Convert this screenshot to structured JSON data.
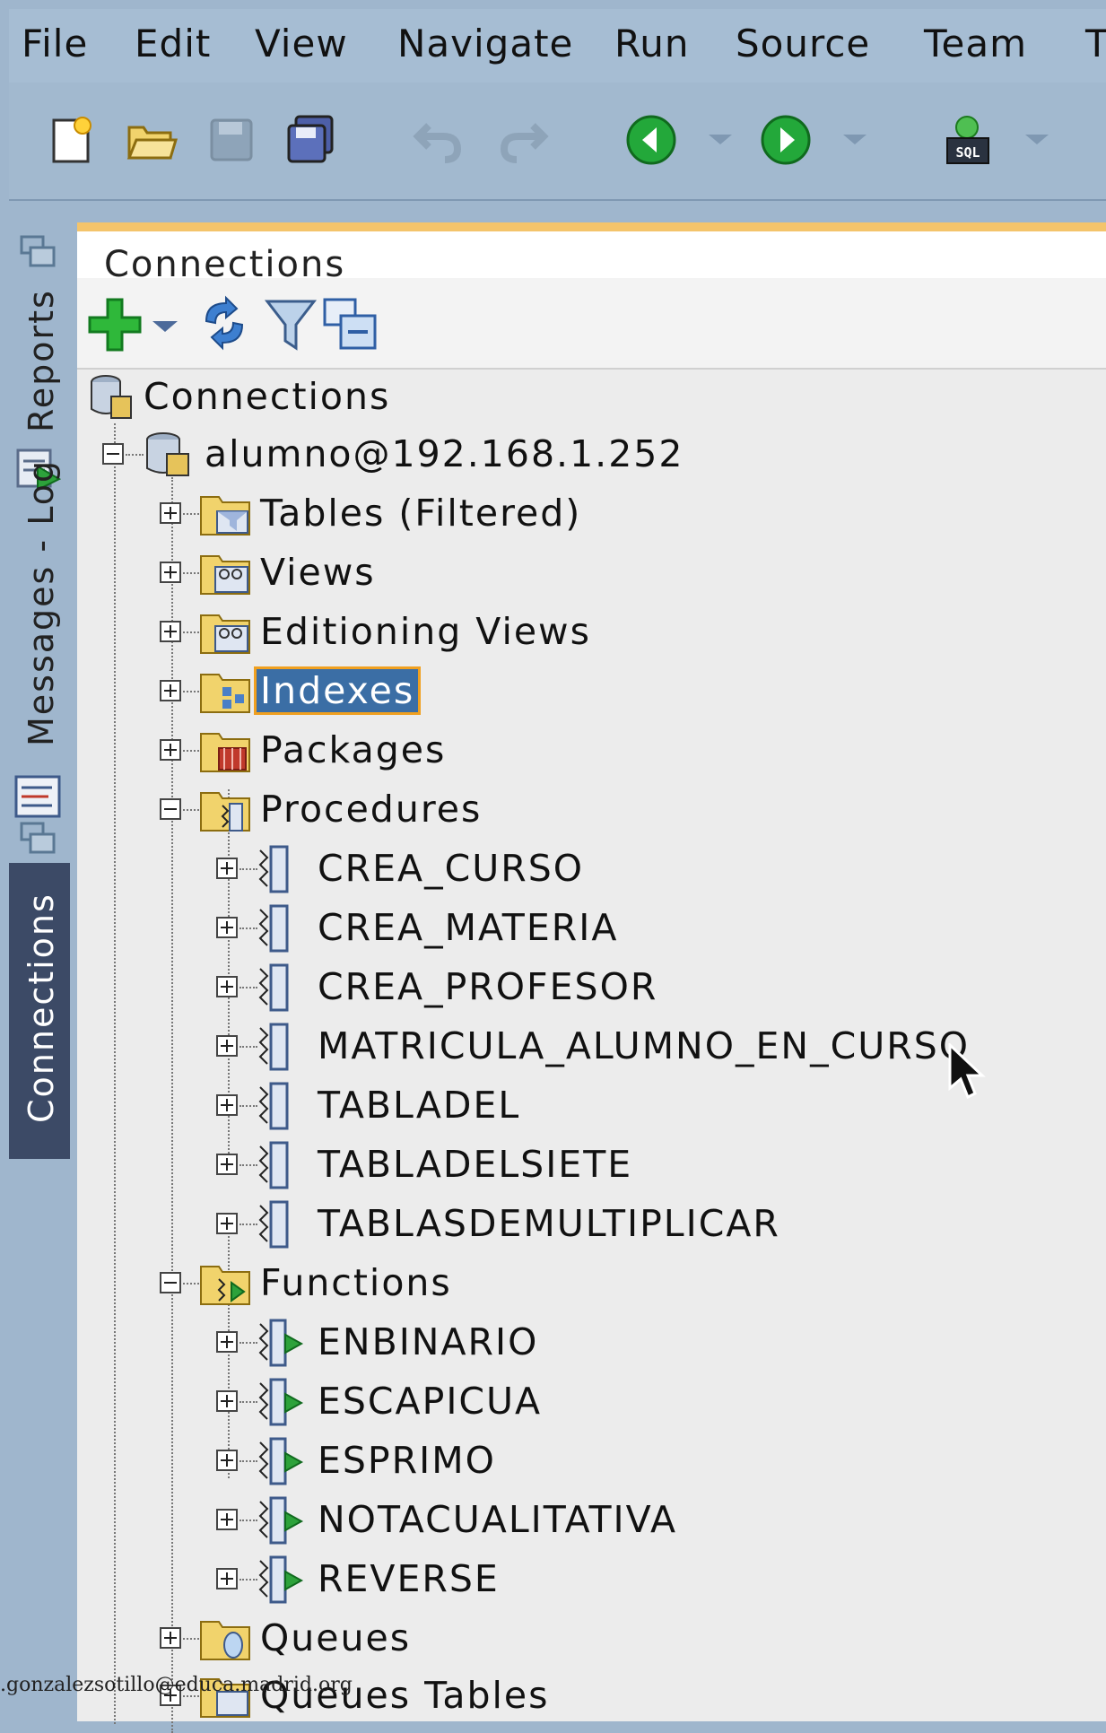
{
  "menubar": {
    "items": [
      "File",
      "Edit",
      "View",
      "Navigate",
      "Run",
      "Source",
      "Team",
      "T"
    ]
  },
  "toolbar": {
    "icons": [
      "new-icon",
      "open-icon",
      "save-icon",
      "save-all-icon",
      "undo-icon",
      "redo-icon",
      "back-icon",
      "forward-icon",
      "sql-worksheet-icon"
    ]
  },
  "sidebar": {
    "tabs": [
      "Reports",
      "Messages - Log",
      "Connections"
    ]
  },
  "panel": {
    "tab_title": "Connections"
  },
  "tree": {
    "root": "Connections",
    "connection": "alumno@192.168.1.252",
    "folders": {
      "tables": "Tables (Filtered)",
      "views": "Views",
      "editioning_views": "Editioning Views",
      "indexes": "Indexes",
      "packages": "Packages",
      "procedures": "Procedures",
      "functions": "Functions",
      "queues": "Queues",
      "queues_tables": "Queues Tables"
    },
    "procedures": [
      "CREA_CURSO",
      "CREA_MATERIA",
      "CREA_PROFESOR",
      "MATRICULA_ALUMNO_EN_CURSO",
      "TABLADEL",
      "TABLADELSIETE",
      "TABLASDEMULTIPLICAR"
    ],
    "functions": [
      "ENBINARIO",
      "ESCAPICUA",
      "ESPRIMO",
      "NOTACUALITATIVA",
      "REVERSE"
    ],
    "selected": "Indexes"
  },
  "watermark": ".gonzalezsotillo@educa.madrid.org",
  "colors": {
    "selection": "#3b6ea5",
    "selection_border": "#f0a020",
    "panel_accent": "#f4c46b"
  }
}
